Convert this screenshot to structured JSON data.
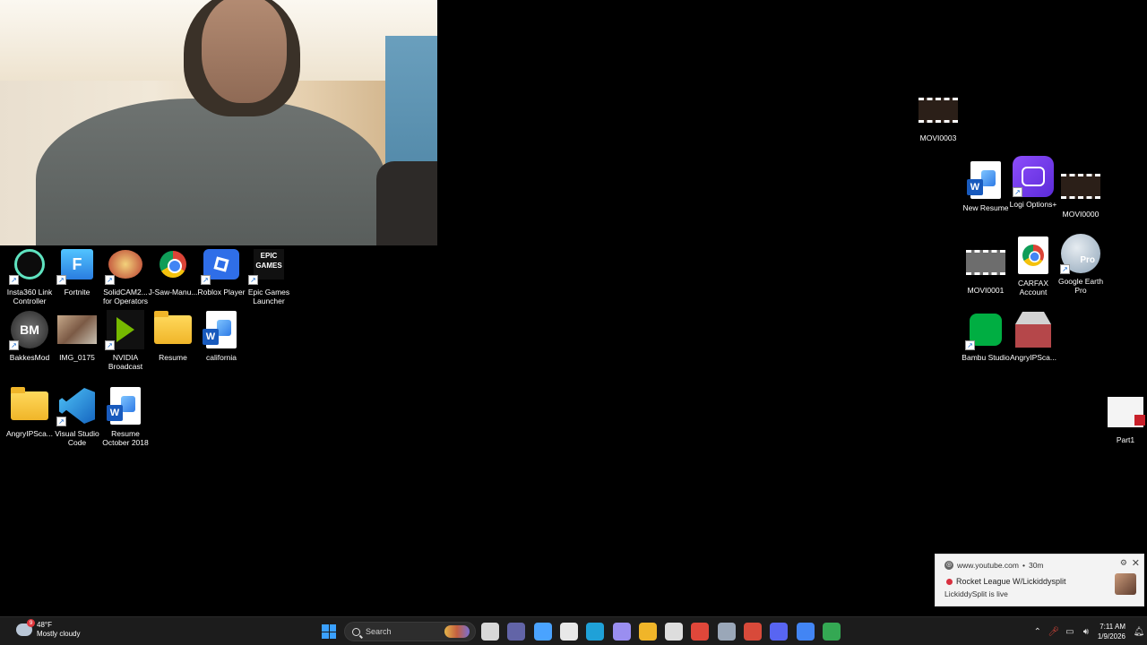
{
  "desktop_icons": [
    {
      "label": "Insta360 Link Controller",
      "icon": "insta360-icon",
      "color": "#0c0c0c"
    },
    {
      "label": "Fortnite",
      "icon": "fortnite-icon",
      "color": "#3aa3ff"
    },
    {
      "label": "SolidCAM2... for Operators",
      "icon": "solidcam-icon",
      "color": "#b83a2e"
    },
    {
      "label": "J-Saw-Manu...",
      "icon": "chrome-icon",
      "color": "#4285f4"
    },
    {
      "label": "Roblox Player",
      "icon": "roblox-icon",
      "color": "#2f6ee8"
    },
    {
      "label": "Epic Games Launcher",
      "icon": "epic-games-icon",
      "color": "#111111"
    },
    {
      "label": "BakkesMod",
      "icon": "bakkesmod-icon",
      "color": "#222222"
    },
    {
      "label": "IMG_0175",
      "icon": "photo-icon",
      "color": "#8a6a55"
    },
    {
      "label": "NVIDIA Broadcast",
      "icon": "nvidia-broadcast-icon",
      "color": "#76b900"
    },
    {
      "label": "Resume",
      "icon": "folder-icon",
      "color": "#f0b529"
    },
    {
      "label": "california",
      "icon": "word-doc-icon",
      "color": "#185abd"
    },
    {
      "label": "AngryIPSca...",
      "icon": "folder-icon",
      "color": "#f0b529"
    },
    {
      "label": "Visual Studio Code",
      "icon": "vscode-icon",
      "color": "#1e88e5"
    },
    {
      "label": "Resume October 2018",
      "icon": "word-doc-icon",
      "color": "#185abd"
    },
    {
      "label": "MOVI0003",
      "icon": "video-file-icon",
      "color": "#3a2418"
    },
    {
      "label": "New Resume",
      "icon": "word-doc-icon",
      "color": "#185abd"
    },
    {
      "label": "Logi Options+",
      "icon": "logi-options-icon",
      "color": "#7b3ff2"
    },
    {
      "label": "MOVI0000",
      "icon": "video-file-icon",
      "color": "#3a2418"
    },
    {
      "label": "MOVI0001",
      "icon": "video-file-icon",
      "color": "#6d6d6d"
    },
    {
      "label": "CARFAX Account",
      "icon": "chrome-doc-icon",
      "color": "#4285f4"
    },
    {
      "label": "Google Earth Pro",
      "icon": "google-earth-icon",
      "color": "#8ea4b8"
    },
    {
      "label": "Bambu Studio",
      "icon": "bambu-studio-icon",
      "color": "#00ae42"
    },
    {
      "label": "AngryIPSca...",
      "icon": "angry-ip-scanner-icon",
      "color": "#b5474a"
    },
    {
      "label": "Part1",
      "icon": "part-file-icon",
      "color": "#c8c8c8"
    }
  ],
  "notification": {
    "source": "www.youtube.com",
    "time": "30m",
    "title": "Rocket League W/Lickiddysplit",
    "body": "LickiddySplit is live",
    "gear_icon": "settings-icon",
    "close_icon": "close-icon"
  },
  "taskbar": {
    "weather_badge": "9",
    "temperature": "48°F",
    "condition": "Mostly cloudy",
    "search_placeholder": "Search",
    "time": "7:11 AM",
    "date": "1/9/2026",
    "apps": [
      {
        "icon": "task-view-icon",
        "color": "#d8d8d8"
      },
      {
        "icon": "teams-icon",
        "color": "#6264a7"
      },
      {
        "icon": "copilot-icon",
        "color": "#4aa3ff"
      },
      {
        "icon": "store-icon",
        "color": "#e8e8e8"
      },
      {
        "icon": "edge-icon",
        "color": "#1fa1d8"
      },
      {
        "icon": "gaming-icon",
        "color": "#9a8ef0"
      },
      {
        "icon": "file-explorer-icon",
        "color": "#f0b529"
      },
      {
        "icon": "obs-icon",
        "color": "#dddddd"
      },
      {
        "icon": "redcircle-icon",
        "color": "#e0473a"
      },
      {
        "icon": "settings-icon",
        "color": "#9aa7b8"
      },
      {
        "icon": "snipping-icon",
        "color": "#d84a3a"
      },
      {
        "icon": "discord-icon",
        "color": "#5865f2"
      },
      {
        "icon": "chrome-icon",
        "color": "#4285f4"
      },
      {
        "icon": "chrome-alt-icon",
        "color": "#34a853"
      }
    ]
  }
}
